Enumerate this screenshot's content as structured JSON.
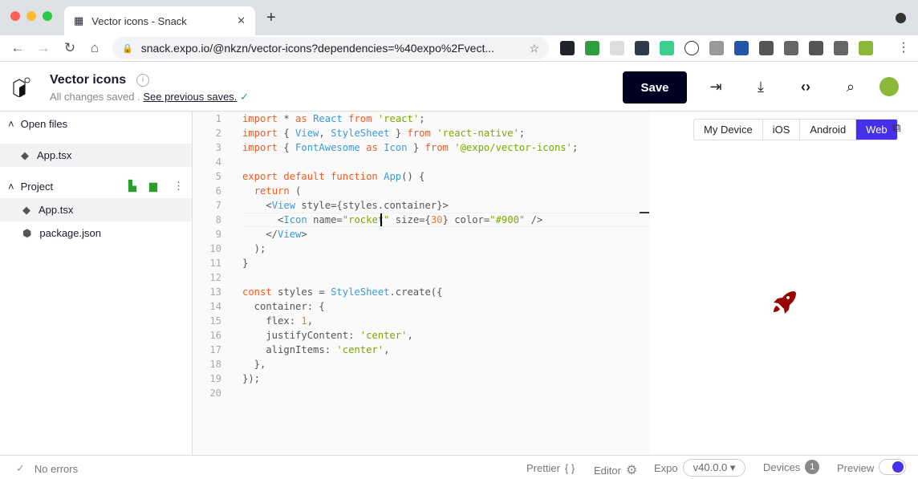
{
  "browser": {
    "tab_title": "Vector icons - Snack",
    "url": "snack.expo.io/@nkzn/vector-icons?dependencies=%40expo%2Fvect...",
    "extensions": [
      "react-devtools",
      "pushbullet",
      "circle-ext",
      "grammarly",
      "notion",
      "a-ext",
      "vue-devtools",
      "rabbit-ext",
      "box-ext",
      "d-ext",
      "extensions",
      "media-control",
      "profile"
    ]
  },
  "header": {
    "title": "Vector icons",
    "status": "All changes saved .",
    "previous_saves_link": "See previous saves.",
    "save_label": "Save"
  },
  "sidebar": {
    "open_files_label": "Open files",
    "open_files": [
      "App.tsx"
    ],
    "project_label": "Project",
    "project_files": [
      {
        "name": "App.tsx",
        "icon": "tsx-file-icon"
      },
      {
        "name": "package.json",
        "icon": "package-icon"
      }
    ]
  },
  "editor": {
    "lines": [
      [
        [
          "kw",
          "import"
        ],
        [
          "pl",
          " * "
        ],
        [
          "kw",
          "as"
        ],
        [
          "pl",
          " "
        ],
        [
          "id",
          "React"
        ],
        [
          "pl",
          " "
        ],
        [
          "kw",
          "from"
        ],
        [
          "pl",
          " "
        ],
        [
          "str",
          "'react'"
        ],
        [
          "pl",
          ";"
        ]
      ],
      [
        [
          "kw",
          "import"
        ],
        [
          "pl",
          " { "
        ],
        [
          "id",
          "View"
        ],
        [
          "pl",
          ", "
        ],
        [
          "id",
          "StyleSheet"
        ],
        [
          "pl",
          " } "
        ],
        [
          "kw",
          "from"
        ],
        [
          "pl",
          " "
        ],
        [
          "str",
          "'react-native'"
        ],
        [
          "pl",
          ";"
        ]
      ],
      [
        [
          "kw",
          "import"
        ],
        [
          "pl",
          " { "
        ],
        [
          "id",
          "FontAwesome"
        ],
        [
          "pl",
          " "
        ],
        [
          "kw",
          "as"
        ],
        [
          "pl",
          " "
        ],
        [
          "id",
          "Icon"
        ],
        [
          "pl",
          " } "
        ],
        [
          "kw",
          "from"
        ],
        [
          "pl",
          " "
        ],
        [
          "str",
          "'@expo/vector-icons'"
        ],
        [
          "pl",
          ";"
        ]
      ],
      [],
      [
        [
          "kw",
          "export default function"
        ],
        [
          "pl",
          " "
        ],
        [
          "id",
          "App"
        ],
        [
          "pl",
          "() {"
        ]
      ],
      [
        [
          "pl",
          "  "
        ],
        [
          "kw",
          "return"
        ],
        [
          "pl",
          " ("
        ]
      ],
      [
        [
          "pl",
          "    <"
        ],
        [
          "id",
          "View"
        ],
        [
          "pl",
          " style={styles.container}>"
        ]
      ],
      [
        [
          "pl",
          "      <"
        ],
        [
          "id",
          "Icon"
        ],
        [
          "pl",
          " name="
        ],
        [
          "str",
          "\"rocket\""
        ],
        [
          "pl",
          " size={"
        ],
        [
          "num",
          "30"
        ],
        [
          "pl",
          "} color="
        ],
        [
          "str",
          "\"#900\""
        ],
        [
          "pl",
          " />"
        ]
      ],
      [
        [
          "pl",
          "    </"
        ],
        [
          "id",
          "View"
        ],
        [
          "pl",
          ">"
        ]
      ],
      [
        [
          "pl",
          "  );"
        ]
      ],
      [
        [
          "pl",
          "}"
        ]
      ],
      [],
      [
        [
          "kw",
          "const"
        ],
        [
          "pl",
          " styles = "
        ],
        [
          "id",
          "StyleSheet"
        ],
        [
          "pl",
          ".create({"
        ]
      ],
      [
        [
          "pl",
          "  container: {"
        ]
      ],
      [
        [
          "pl",
          "    flex: "
        ],
        [
          "num",
          "1"
        ],
        [
          "pl",
          ","
        ]
      ],
      [
        [
          "pl",
          "    justifyContent: "
        ],
        [
          "str",
          "'center'"
        ],
        [
          "pl",
          ","
        ]
      ],
      [
        [
          "pl",
          "    alignItems: "
        ],
        [
          "str",
          "'center'"
        ],
        [
          "pl",
          ","
        ]
      ],
      [
        [
          "pl",
          "  },"
        ]
      ],
      [
        [
          "pl",
          "});"
        ]
      ],
      []
    ]
  },
  "preview": {
    "device_tabs": [
      "My Device",
      "iOS",
      "Android",
      "Web"
    ],
    "active_tab": "Web",
    "icon_color": "#990000"
  },
  "status": {
    "errors": "No errors",
    "prettier": "Prettier",
    "prettier_icon": "{ }",
    "editor": "Editor",
    "expo": "Expo",
    "expo_version": "v40.0.0 ▾",
    "devices": "Devices",
    "device_count": "1",
    "preview": "Preview",
    "preview_enabled": true
  },
  "colors": {
    "accent": "#4630eb",
    "save_bg": "#000022",
    "keyword": "#f25a1f",
    "identifier": "#3a9ad9",
    "string": "#7aa800"
  }
}
